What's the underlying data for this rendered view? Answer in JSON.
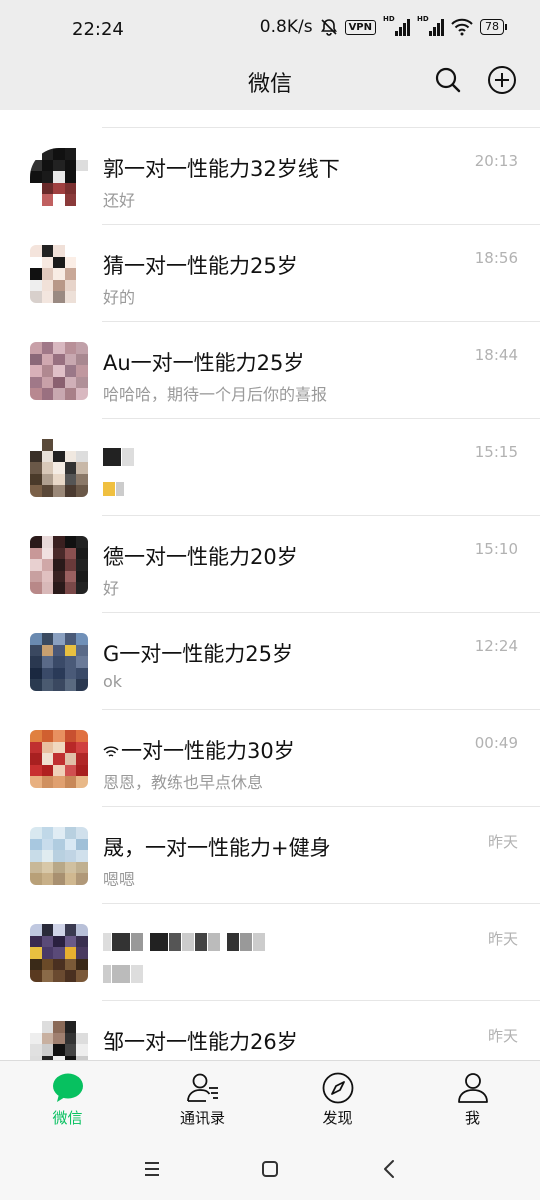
{
  "status_bar": {
    "time": "22:24",
    "net_speed": "0.8K/s",
    "vpn_label": "VPN",
    "hd_label": "HD",
    "battery": "78"
  },
  "header": {
    "title": "微信"
  },
  "chats": [
    {
      "name": "",
      "preview": "",
      "time": ""
    },
    {
      "name": "郭一对一性能力32岁线下",
      "preview": "还好",
      "time": "20:13"
    },
    {
      "name": "猜一对一性能力25岁",
      "preview": "好的",
      "time": "18:56"
    },
    {
      "name": "Au一对一性能力25岁",
      "preview": "哈哈哈，期待一个月后你的喜报",
      "time": "18:44"
    },
    {
      "name": "",
      "preview": "",
      "time": "15:15"
    },
    {
      "name": "德一对一性能力20岁",
      "preview": "好",
      "time": "15:10"
    },
    {
      "name": "G一对一性能力25岁",
      "preview": "ok",
      "time": "12:24"
    },
    {
      "name": "一对一性能力30岁",
      "preview": "恩恩，教练也早点休息",
      "time": "00:49"
    },
    {
      "name": "晟，一对一性能力+健身",
      "preview": "嗯嗯",
      "time": "昨天"
    },
    {
      "name": "",
      "preview": "",
      "time": "昨天"
    },
    {
      "name": "邹一对一性能力26岁",
      "preview": "",
      "time": "昨天"
    }
  ],
  "tabs": [
    {
      "label": "微信",
      "icon": "chat-bubble-icon",
      "active": true
    },
    {
      "label": "通讯录",
      "icon": "contacts-icon",
      "active": false
    },
    {
      "label": "发现",
      "icon": "compass-icon",
      "active": false
    },
    {
      "label": "我",
      "icon": "person-icon",
      "active": false
    }
  ],
  "colors": {
    "accent": "#07c160",
    "background": "#ededed",
    "preview_text": "#9a9a9a"
  }
}
